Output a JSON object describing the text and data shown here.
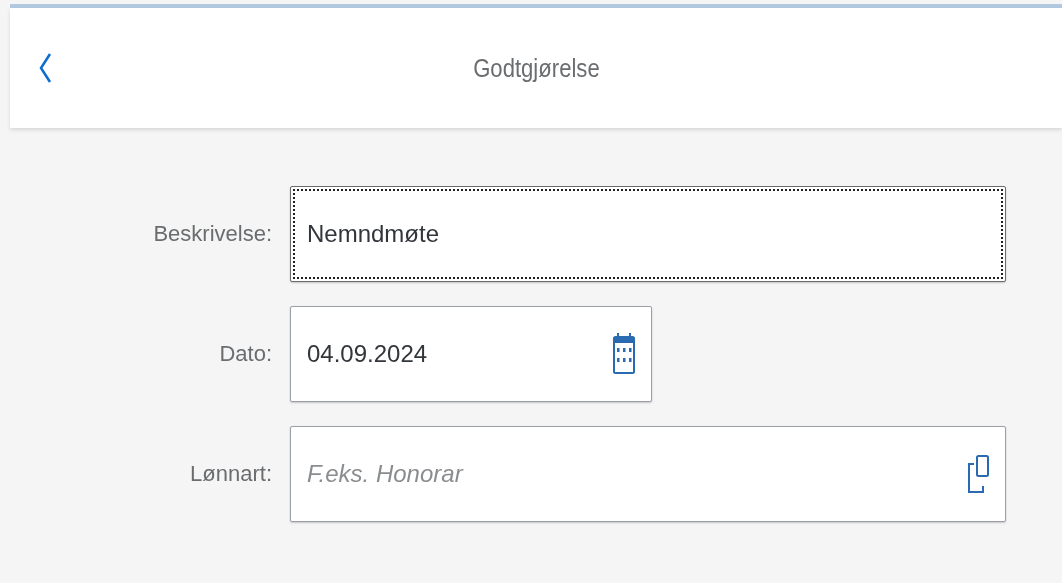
{
  "header": {
    "title": "Godtgjørelse"
  },
  "fields": [
    {
      "label": "Beskrivelse:",
      "kind": "text",
      "value": "Nemndmøte",
      "focused": true
    },
    {
      "label": "Dato:",
      "kind": "date",
      "value": "04.09.2024",
      "focused": false
    },
    {
      "label": "Lønnart:",
      "kind": "valuehelp",
      "placeholder": "F.eks. Honorar",
      "focused": false
    }
  ]
}
